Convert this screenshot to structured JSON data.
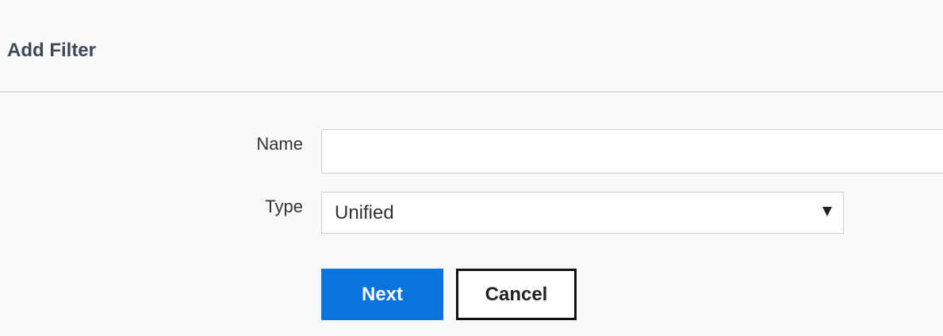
{
  "dialog": {
    "title": "Add Filter"
  },
  "form": {
    "name_label": "Name",
    "name_value": "",
    "name_placeholder": "",
    "type_label": "Type",
    "type_selected": "Unified",
    "type_icon": "caret-down-icon"
  },
  "actions": {
    "next_label": "Next",
    "cancel_label": "Cancel"
  },
  "colors": {
    "primary": "#0b73e0",
    "title": "#3c4a57"
  }
}
